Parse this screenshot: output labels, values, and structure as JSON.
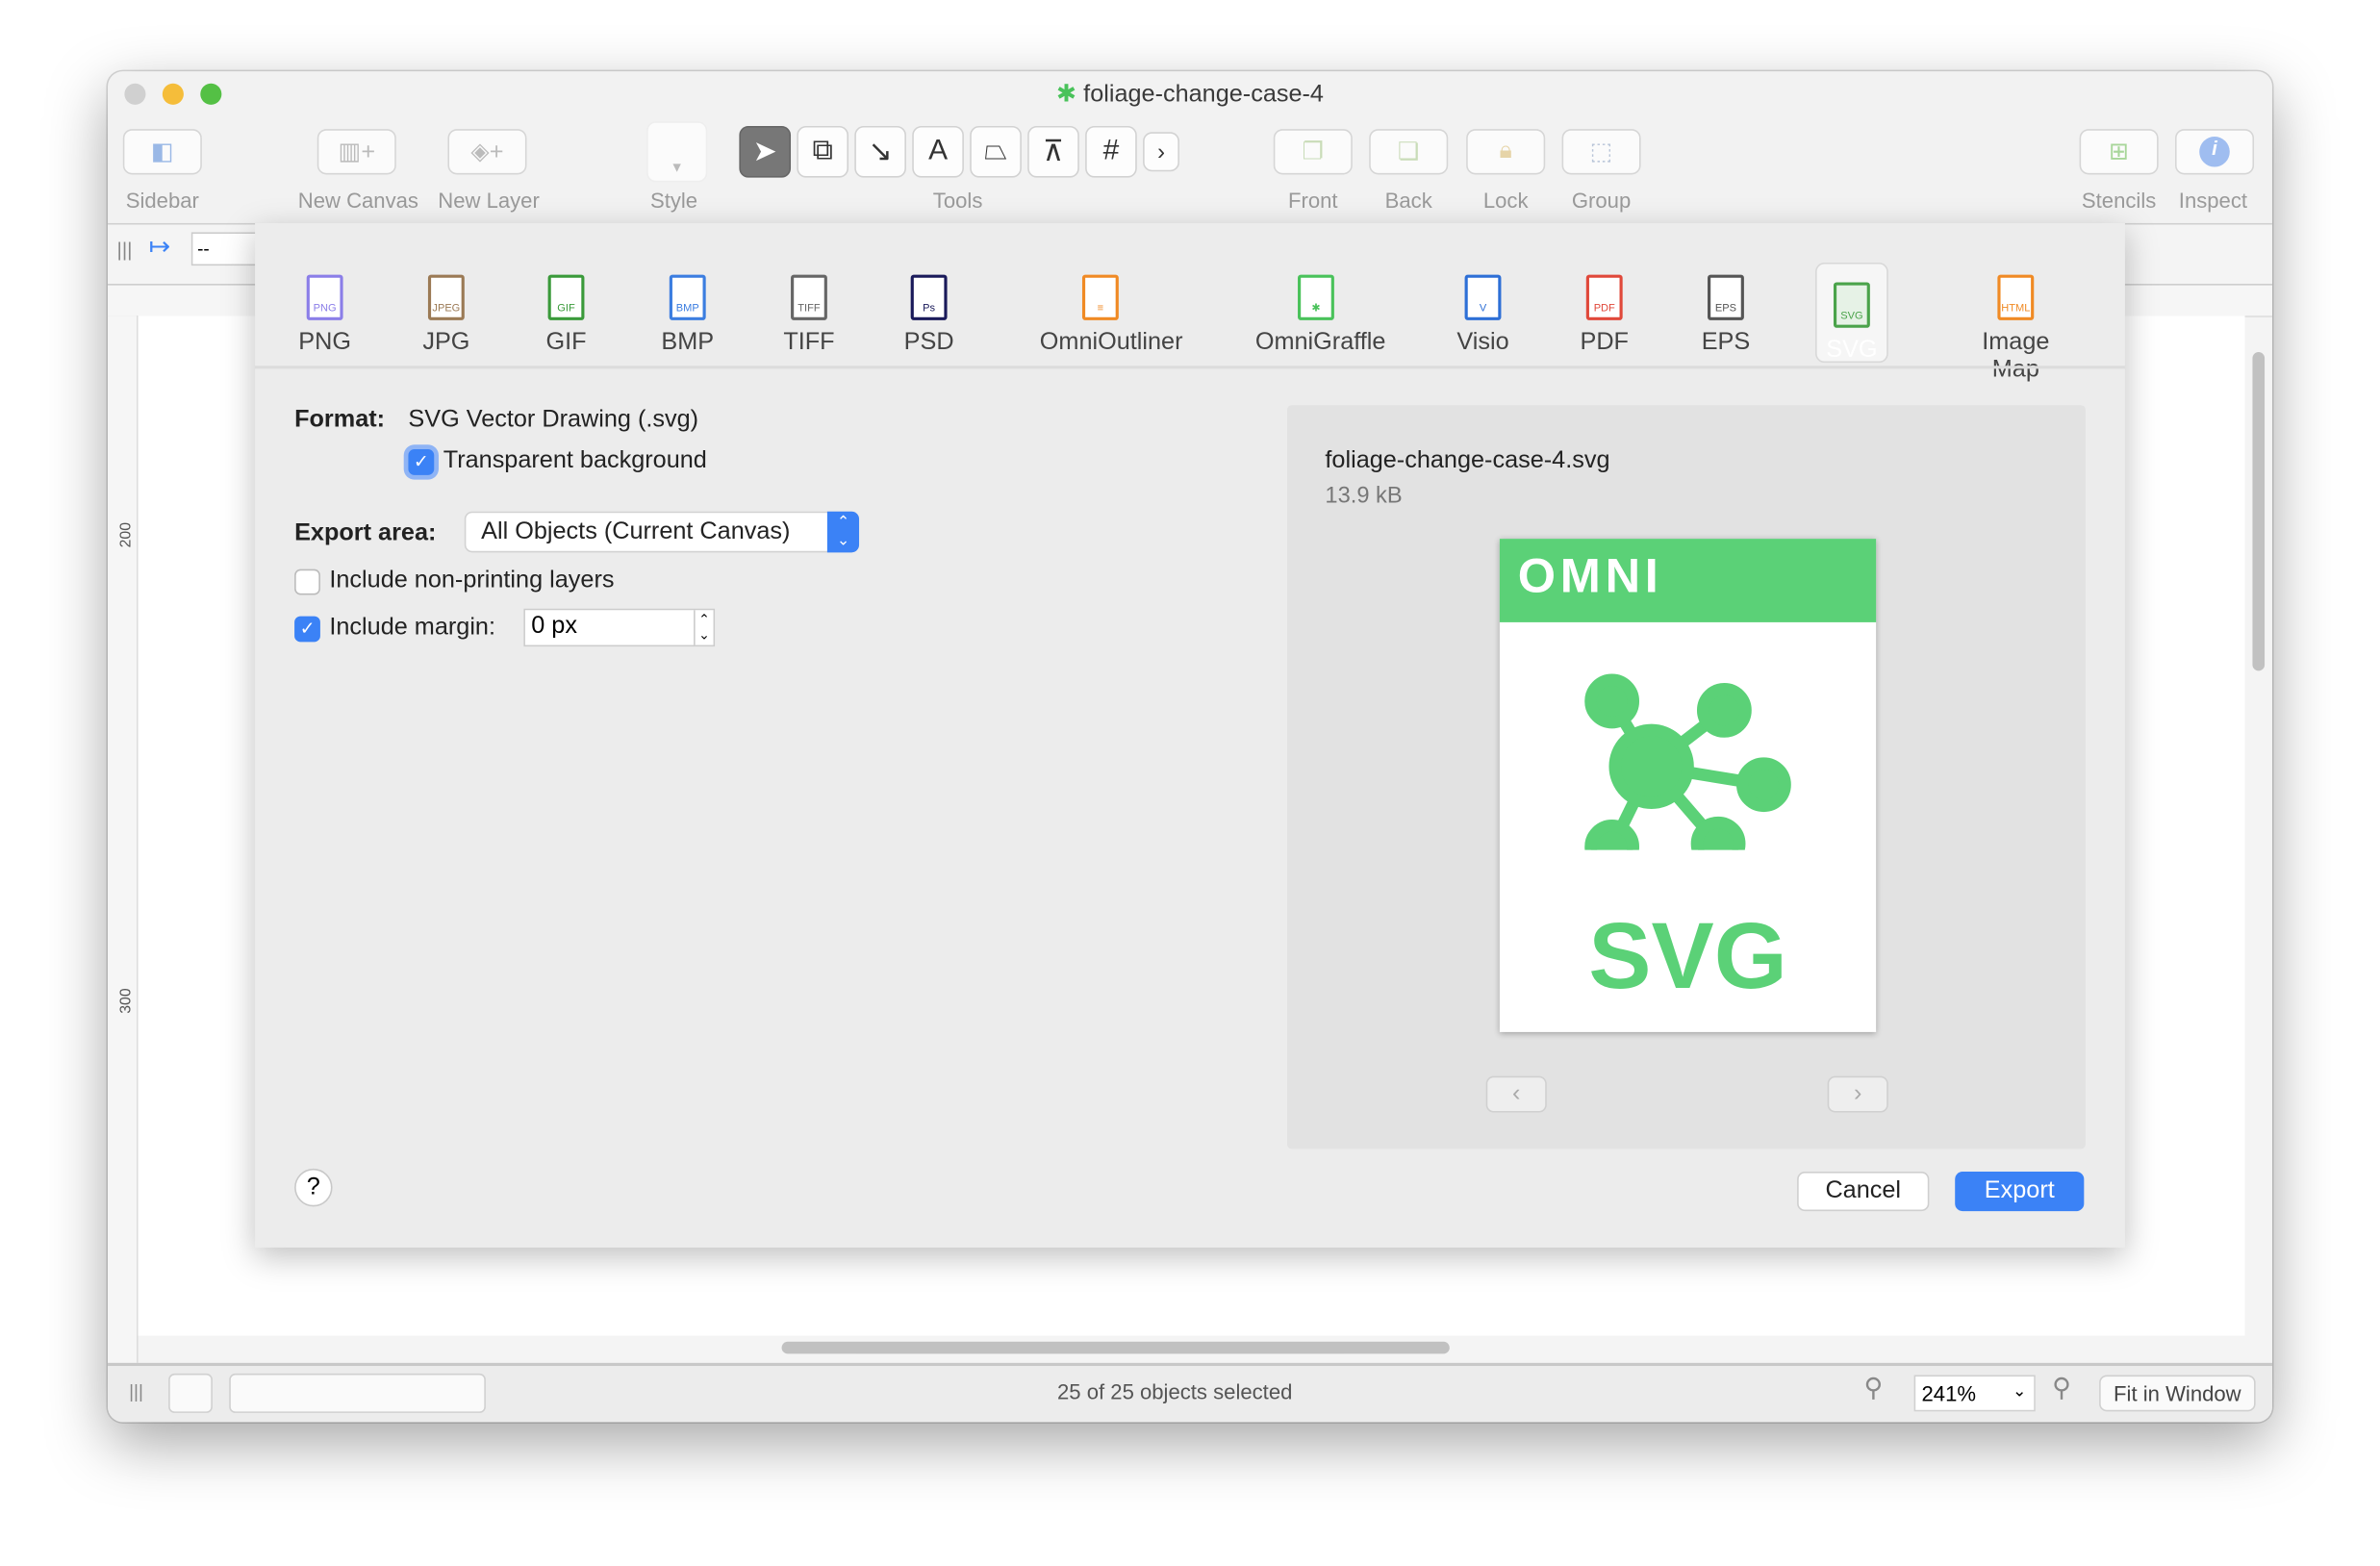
{
  "window": {
    "title": "foliage-change-case-4"
  },
  "toolbar": {
    "left": [
      {
        "label": "Sidebar",
        "icon": "sidebar-icon"
      },
      {
        "label": "New Canvas",
        "icon": "new-canvas-icon"
      },
      {
        "label": "New Layer",
        "icon": "new-layer-icon"
      },
      {
        "label": "Style",
        "icon": "style-icon"
      }
    ],
    "tools_label": "Tools",
    "tools": [
      "select-tool",
      "shape-tool",
      "line-tool",
      "text-tool",
      "pen-tool",
      "point-edit-tool",
      "diagram-tool",
      "more-tools"
    ],
    "arrange": [
      {
        "label": "Front"
      },
      {
        "label": "Back"
      },
      {
        "label": "Lock"
      },
      {
        "label": "Group"
      }
    ],
    "right": [
      {
        "label": "Stencils"
      },
      {
        "label": "Inspect"
      }
    ]
  },
  "ruler": {
    "field": "--",
    "marks": [
      "200",
      "300"
    ]
  },
  "export": {
    "formats": [
      {
        "label": "PNG",
        "tag": "PNG",
        "color": "#8b7ee8"
      },
      {
        "label": "JPG",
        "tag": "JPEG",
        "color": "#9b7a55"
      },
      {
        "label": "GIF",
        "tag": "GIF",
        "color": "#3a9a3a"
      },
      {
        "label": "BMP",
        "tag": "BMP",
        "color": "#3b7de0"
      },
      {
        "label": "TIFF",
        "tag": "TIFF",
        "color": "#666666"
      },
      {
        "label": "PSD",
        "tag": "Ps",
        "color": "#1a1a5a"
      },
      {
        "label": "OmniOutliner",
        "tag": "≡",
        "color": "#f08a24"
      },
      {
        "label": "OmniGraffle",
        "tag": "✱",
        "color": "#49c25a"
      },
      {
        "label": "Visio",
        "tag": "V",
        "color": "#2d6fd6"
      },
      {
        "label": "PDF",
        "tag": "PDF",
        "color": "#e0483a"
      },
      {
        "label": "EPS",
        "tag": "EPS",
        "color": "#555555"
      },
      {
        "label": "SVG",
        "tag": "SVG",
        "color": "#4aa34a",
        "selected": true
      },
      {
        "label": "Image Map",
        "tag": "HTML",
        "color": "#f08a24"
      }
    ],
    "format_label": "Format:",
    "format_value": "SVG Vector Drawing (.svg)",
    "transparent_label": "Transparent background",
    "transparent_checked": true,
    "area_label": "Export area:",
    "area_value": "All Objects (Current Canvas)",
    "nonprinting_label": "Include non-printing layers",
    "nonprinting_checked": false,
    "margin_label": "Include margin:",
    "margin_checked": true,
    "margin_value": "0 px",
    "preview": {
      "filename": "foliage-change-case-4.svg",
      "size": "13.9 kB",
      "badge": "SVG",
      "brand": "OMNI"
    },
    "help": "?",
    "cancel": "Cancel",
    "export": "Export",
    "accent": "#3b82f6"
  },
  "status": {
    "text": "25 of 25 objects selected",
    "zoom": "241%",
    "fit": "Fit in Window"
  }
}
